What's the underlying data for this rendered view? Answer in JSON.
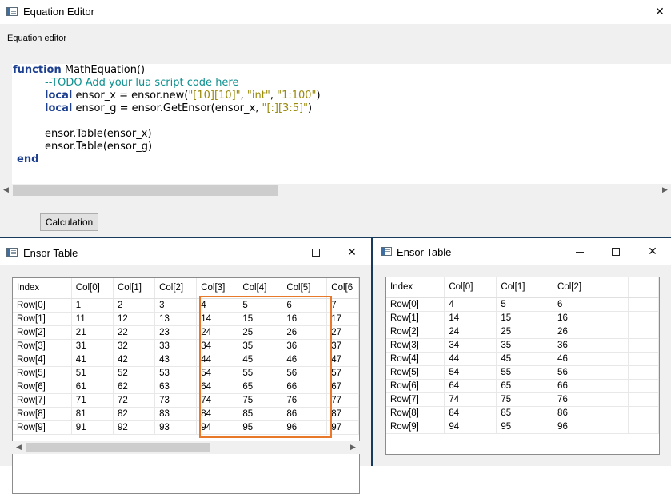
{
  "editor": {
    "window_title": "Equation Editor",
    "label": "Equation editor",
    "code": {
      "line1": {
        "kw": "function",
        "rest": " MathEquation()"
      },
      "line2": {
        "comment": "--TODO Add your lua script code here"
      },
      "line3": {
        "kw": "local",
        "a": " ensor_x = ensor.new(",
        "s1": "\"[10][10]\"",
        "c1": ", ",
        "s2": "\"int\"",
        "c2": ", ",
        "s3": "\"1:100\"",
        "end": ")"
      },
      "line4": {
        "kw": "local",
        "a": " ensor_g = ensor.GetEnsor(ensor_x, ",
        "s1": "\"[:][3:5]\"",
        "end": ")"
      },
      "line5": "ensor.Table(ensor_x)",
      "line6": "ensor.Table(ensor_g)",
      "line7": {
        "kw": "end"
      }
    },
    "calculation_button": "Calculation"
  },
  "table1": {
    "window_title": "Ensor Table",
    "headers": [
      "Index",
      "Col[0]",
      "Col[1]",
      "Col[2]",
      "Col[3]",
      "Col[4]",
      "Col[5]",
      "Col[6"
    ],
    "rows": [
      [
        "Row[0]",
        "1",
        "2",
        "3",
        "4",
        "5",
        "6",
        "7"
      ],
      [
        "Row[1]",
        "11",
        "12",
        "13",
        "14",
        "15",
        "16",
        "17"
      ],
      [
        "Row[2]",
        "21",
        "22",
        "23",
        "24",
        "25",
        "26",
        "27"
      ],
      [
        "Row[3]",
        "31",
        "32",
        "33",
        "34",
        "35",
        "36",
        "37"
      ],
      [
        "Row[4]",
        "41",
        "42",
        "43",
        "44",
        "45",
        "46",
        "47"
      ],
      [
        "Row[5]",
        "51",
        "52",
        "53",
        "54",
        "55",
        "56",
        "57"
      ],
      [
        "Row[6]",
        "61",
        "62",
        "63",
        "64",
        "65",
        "66",
        "67"
      ],
      [
        "Row[7]",
        "71",
        "72",
        "73",
        "74",
        "75",
        "76",
        "77"
      ],
      [
        "Row[8]",
        "81",
        "82",
        "83",
        "84",
        "85",
        "86",
        "87"
      ],
      [
        "Row[9]",
        "91",
        "92",
        "93",
        "94",
        "95",
        "96",
        "97"
      ]
    ],
    "highlight_color": "#e8782a"
  },
  "table2": {
    "window_title": "Ensor Table",
    "headers": [
      "Index",
      "Col[0]",
      "Col[1]",
      "Col[2]",
      ""
    ],
    "rows": [
      [
        "Row[0]",
        "4",
        "5",
        "6",
        ""
      ],
      [
        "Row[1]",
        "14",
        "15",
        "16",
        ""
      ],
      [
        "Row[2]",
        "24",
        "25",
        "26",
        ""
      ],
      [
        "Row[3]",
        "34",
        "35",
        "36",
        ""
      ],
      [
        "Row[4]",
        "44",
        "45",
        "46",
        ""
      ],
      [
        "Row[5]",
        "54",
        "55",
        "56",
        ""
      ],
      [
        "Row[6]",
        "64",
        "65",
        "66",
        ""
      ],
      [
        "Row[7]",
        "74",
        "75",
        "76",
        ""
      ],
      [
        "Row[8]",
        "84",
        "85",
        "86",
        ""
      ],
      [
        "Row[9]",
        "94",
        "95",
        "96",
        ""
      ]
    ]
  },
  "glyphs": {
    "close": "✕",
    "left": "◀",
    "right": "▶"
  }
}
